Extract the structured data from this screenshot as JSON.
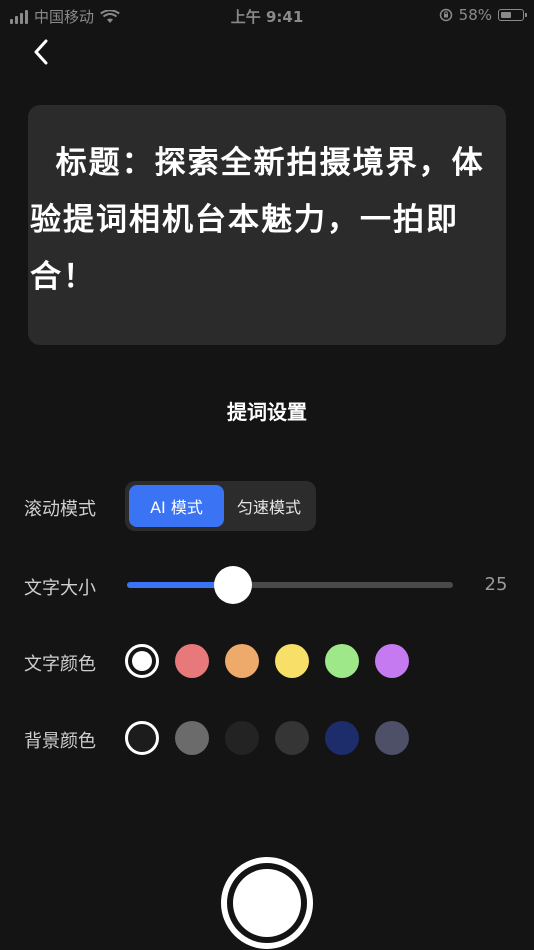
{
  "status_bar": {
    "carrier": "中国移动",
    "time": "上午 9:41",
    "battery": "58%",
    "battery_level": 0.58
  },
  "script": {
    "text": "  标题：探索全新拍摄境界，体验提词相机台本魅力，一拍即合！"
  },
  "settings": {
    "title": "提词设置",
    "scroll_mode": {
      "label": "滚动模式",
      "options": [
        "AI 模式",
        "匀速模式"
      ],
      "selected": "AI 模式"
    },
    "font_size": {
      "label": "文字大小",
      "value": 25,
      "fraction": 0.325
    },
    "text_color": {
      "label": "文字颜色",
      "swatches": [
        "#ffffff",
        "#e8797a",
        "#eeaa6a",
        "#f7df68",
        "#9fe88a",
        "#c57af2"
      ],
      "selected_index": 0
    },
    "bg_color": {
      "label": "背景颜色",
      "swatches": [
        "#1c1c1c",
        "#6b6b6b",
        "#232323",
        "#353535",
        "#1d2c6a",
        "#4d5066"
      ],
      "selected_index": 0
    }
  },
  "icons": {
    "back": "chevron-left-icon",
    "shutter": "record-button"
  }
}
